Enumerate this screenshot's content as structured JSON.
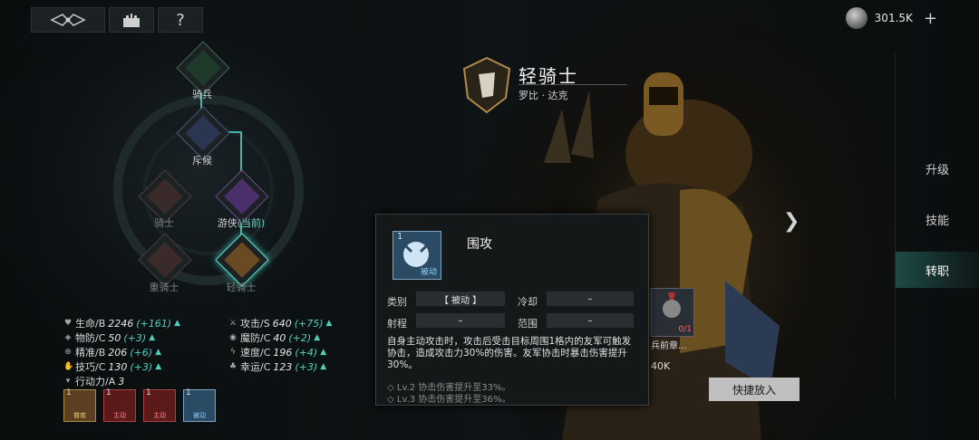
{
  "currency": {
    "amount": "301.5K",
    "icon": "silver-coin-icon"
  },
  "topbar": {
    "help": "?"
  },
  "tree": {
    "cavalry": "骑兵",
    "scout": "斥候",
    "knight": "骑士",
    "ranger": "游侠",
    "ranger_current": "(当前)",
    "heavy_knight": "重骑士",
    "light_knight": "轻骑士"
  },
  "stats": {
    "hp": {
      "label": "生命/B",
      "value": "2246",
      "bonus": "(+161)"
    },
    "pdef": {
      "label": "物防/C",
      "value": "50",
      "bonus": "(+3)"
    },
    "acc": {
      "label": "精准/B",
      "value": "206",
      "bonus": "(+6)"
    },
    "skill": {
      "label": "技巧/C",
      "value": "130",
      "bonus": "(+3)"
    },
    "move": {
      "label": "行动力/A",
      "value": "3"
    },
    "atk": {
      "label": "攻击/S",
      "value": "640",
      "bonus": "(+75)"
    },
    "mdef": {
      "label": "魔防/C",
      "value": "40",
      "bonus": "(+2)"
    },
    "spd": {
      "label": "速度/C",
      "value": "196",
      "bonus": "(+4)"
    },
    "luck": {
      "label": "幸运/C",
      "value": "123",
      "bonus": "(+3)"
    }
  },
  "skills": [
    {
      "num": "1",
      "tag": "普攻"
    },
    {
      "num": "1",
      "tag": "主动"
    },
    {
      "num": "1",
      "tag": "主动"
    },
    {
      "num": "1",
      "tag": "被动"
    }
  ],
  "hero": {
    "class_name": "轻骑士",
    "name": "罗比 · 达克"
  },
  "tabs": {
    "upgrade": "升级",
    "skills": "技能",
    "transfer": "转职"
  },
  "popup": {
    "num": "1",
    "tag": "被动",
    "title": "围攻",
    "type_label": "类别",
    "type_value": "【 被动 】",
    "cooldown_label": "冷却",
    "cooldown_value": "–",
    "range_label": "射程",
    "range_value": "–",
    "area_label": "范围",
    "area_value": "–",
    "desc": "自身主动攻击时，攻击后受击目标周围1格内的友军可触发协击，造成攻击力30%的伤害。友军协击时暴击伤害提升30%。",
    "lv2": "◇ Lv.2 协击伤害提升至33%。",
    "lv3": "◇ Lv.3 协击伤害提升至36%。"
  },
  "item": {
    "count": "0/1",
    "name": "兵前章...",
    "cost": "40K"
  },
  "quick_button": "快捷放入"
}
